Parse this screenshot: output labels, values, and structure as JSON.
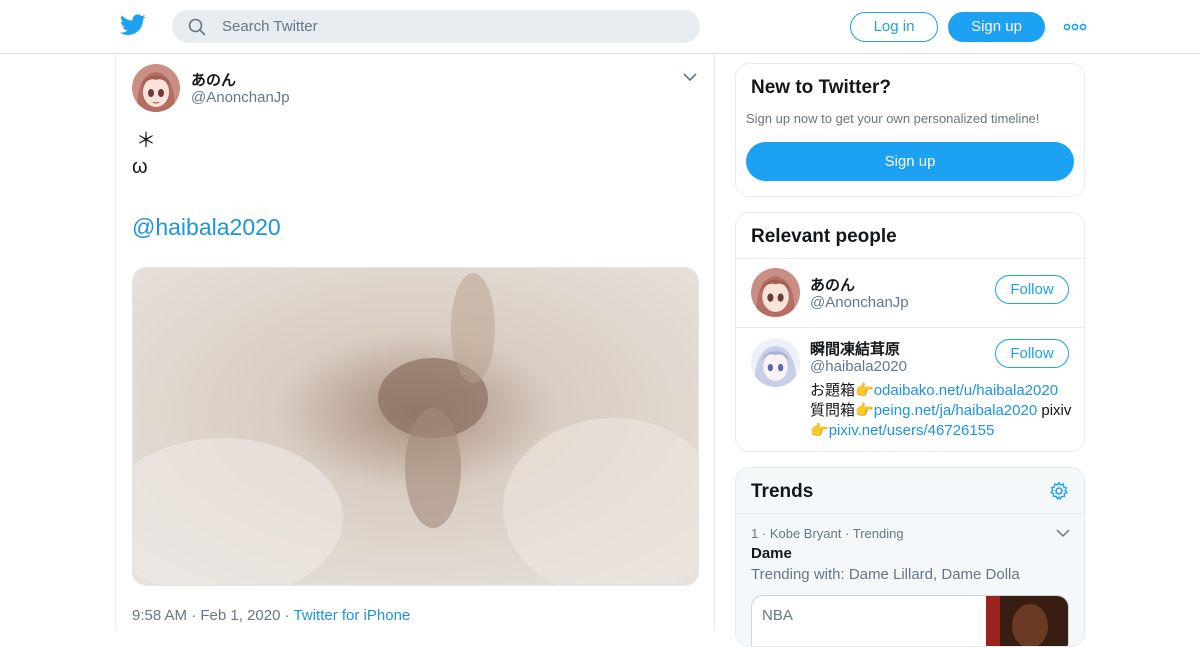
{
  "header": {
    "search_placeholder": "Search Twitter",
    "login_label": "Log in",
    "signup_label": "Sign up",
    "more_icon": "more-dots-icon",
    "brand_color": "#1da1f2"
  },
  "tweet": {
    "author_name": "あのん",
    "author_handle": "@AnonchanJp",
    "line1": "＊",
    "line2": "ω",
    "mention": "@haibala2020",
    "time": "9:58 AM",
    "date": "Feb 1, 2020",
    "source": "Twitter for iPhone",
    "sep": "·"
  },
  "new_to_twitter": {
    "title": "New to Twitter?",
    "subtitle": "Sign up now to get your own personalized timeline!",
    "button": "Sign up"
  },
  "relevant_people": {
    "title": "Relevant people",
    "people": [
      {
        "name": "あのん",
        "handle": "@AnonchanJp",
        "follow": "Follow"
      },
      {
        "name": "瞬間凍結茸原",
        "handle": "@haibala2020",
        "follow": "Follow",
        "bio_prefix1": "お題箱",
        "bio_emoji": "👉",
        "bio_link1": "odaibako.net/u/haibala2020",
        "bio_prefix2": "質問箱",
        "bio_link2": "peing.net/ja/haibala2020",
        "bio_text3": "pixiv",
        "bio_link3": "pixiv.net/users/46726155"
      }
    ]
  },
  "trends": {
    "title": "Trends",
    "items": [
      {
        "rank": "1",
        "category": "Kobe Bryant",
        "status": "Trending",
        "name": "Dame",
        "with": "Trending with: Dame Lillard, Dame Dolla",
        "card_label": "NBA"
      }
    ],
    "sep": "·"
  }
}
